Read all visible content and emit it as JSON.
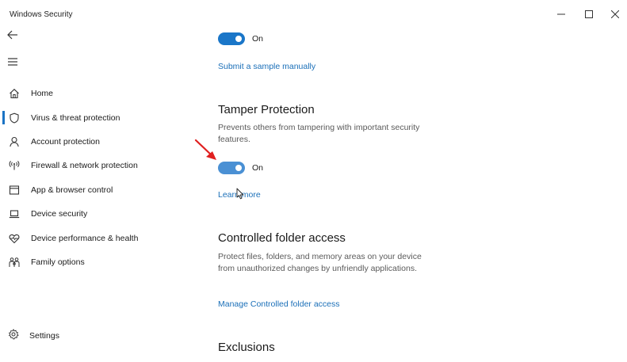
{
  "window": {
    "title": "Windows Security",
    "minimize_icon": "minimize-icon",
    "maximize_icon": "maximize-icon",
    "close_icon": "close-icon"
  },
  "nav": {
    "back_icon": "back-arrow-icon",
    "menu_icon": "hamburger-menu-icon",
    "items": [
      {
        "label": "Home",
        "icon": "home-icon",
        "active": false
      },
      {
        "label": "Virus & threat protection",
        "icon": "shield-icon",
        "active": true
      },
      {
        "label": "Account protection",
        "icon": "person-icon",
        "active": false
      },
      {
        "label": "Firewall & network protection",
        "icon": "wifi-antenna-icon",
        "active": false
      },
      {
        "label": "App & browser control",
        "icon": "browser-window-icon",
        "active": false
      },
      {
        "label": "Device security",
        "icon": "laptop-icon",
        "active": false
      },
      {
        "label": "Device performance & health",
        "icon": "heart-pulse-icon",
        "active": false
      },
      {
        "label": "Family options",
        "icon": "family-icon",
        "active": false
      }
    ],
    "settings_label": "Settings",
    "settings_icon": "gear-icon"
  },
  "main": {
    "sample_submission": {
      "toggle_state": "On",
      "link": "Submit a sample manually"
    },
    "tamper_protection": {
      "title": "Tamper Protection",
      "description": "Prevents others from tampering with important security features.",
      "toggle_state": "On",
      "link": "Learn more"
    },
    "controlled_folder_access": {
      "title": "Controlled folder access",
      "description": "Protect files, folders, and memory areas on your device from unauthorized changes by unfriendly applications.",
      "link": "Manage Controlled folder access"
    },
    "exclusions": {
      "title": "Exclusions"
    }
  },
  "colors": {
    "accent": "#1a76c8",
    "link": "#1a6fb8",
    "annotation_arrow": "#e02020"
  }
}
